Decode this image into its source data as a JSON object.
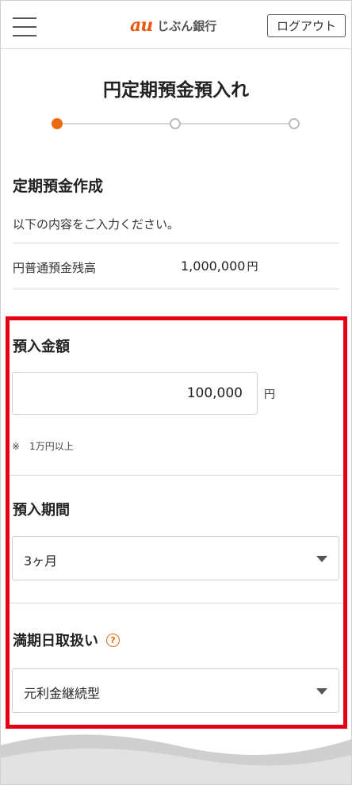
{
  "header": {
    "logo_au": "au",
    "logo_bank": "じぶん銀行",
    "logout_label": "ログアウト",
    "menu_icon": "hamburger-menu-icon"
  },
  "page": {
    "title": "円定期預金預入れ",
    "stepper": {
      "total_steps": 3,
      "current_step": 1
    }
  },
  "section": {
    "title": "定期預金作成",
    "intro": "以下の内容をご入力ください。",
    "balance_label": "円普通預金残高",
    "balance_value": "1,000,000",
    "balance_unit": "円"
  },
  "form": {
    "amount": {
      "label": "預入金額",
      "value": "100,000",
      "unit": "円",
      "note": "※　1万円以上"
    },
    "period": {
      "label": "預入期間",
      "selected": "3ヶ月"
    },
    "maturity": {
      "label": "満期日取扱い",
      "help_icon": "question-circle-icon",
      "help_glyph": "?",
      "selected": "元利金継続型"
    }
  },
  "colors": {
    "accent": "#eb6b12",
    "highlight_border": "#e60012",
    "divider": "#dcdcdc"
  }
}
